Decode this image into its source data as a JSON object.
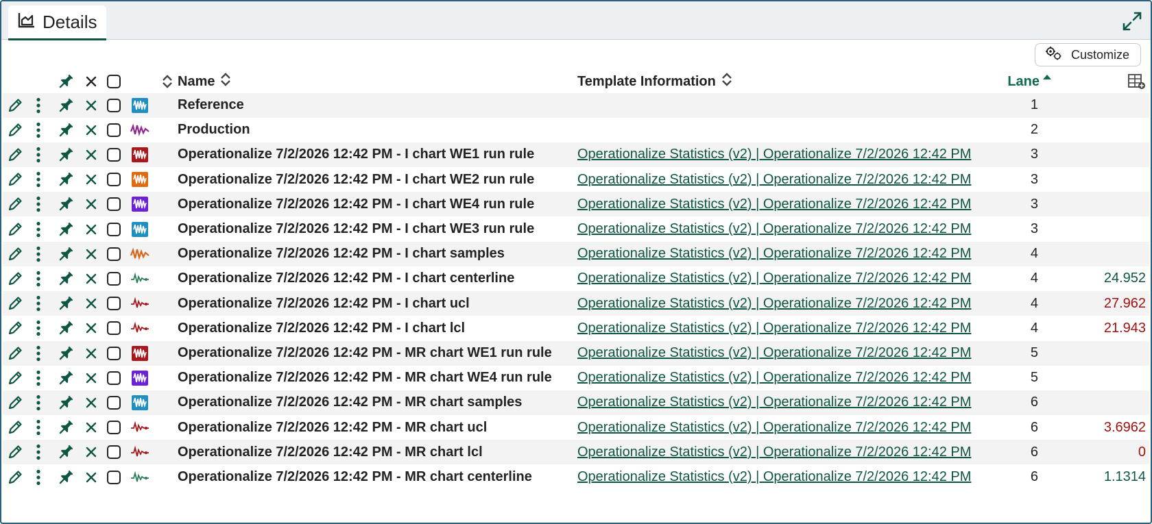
{
  "tab": {
    "label": "Details"
  },
  "toolbar": {
    "customize_label": "Customize"
  },
  "header": {
    "name": "Name",
    "template": "Template Information",
    "lane": "Lane"
  },
  "colors": {
    "accent": "#0f5543",
    "value_positive": "#0f5543",
    "value_limit": "#a01010"
  },
  "rows": [
    {
      "name": "Reference",
      "template": "",
      "lane": "1",
      "value": "",
      "icon": "signal-blue-icon"
    },
    {
      "name": "Production",
      "template": "",
      "lane": "2",
      "value": "",
      "icon": "signal-purple-icon"
    },
    {
      "name": "Operationalize 7/2/2026 12:42 PM - I chart WE1 run rule",
      "template": "Operationalize Statistics (v2) | Operationalize 7/2/2026 12:42 PM",
      "lane": "3",
      "value": "",
      "icon": "runrule-red-icon"
    },
    {
      "name": "Operationalize 7/2/2026 12:42 PM - I chart WE2 run rule",
      "template": "Operationalize Statistics (v2) | Operationalize 7/2/2026 12:42 PM",
      "lane": "3",
      "value": "",
      "icon": "runrule-orange-icon"
    },
    {
      "name": "Operationalize 7/2/2026 12:42 PM - I chart WE4 run rule",
      "template": "Operationalize Statistics (v2) | Operationalize 7/2/2026 12:42 PM",
      "lane": "3",
      "value": "",
      "icon": "runrule-purple-icon"
    },
    {
      "name": "Operationalize 7/2/2026 12:42 PM - I chart WE3 run rule",
      "template": "Operationalize Statistics (v2) | Operationalize 7/2/2026 12:42 PM",
      "lane": "3",
      "value": "",
      "icon": "runrule-blue-icon"
    },
    {
      "name": "Operationalize 7/2/2026 12:42 PM - I chart samples",
      "template": "Operationalize Statistics (v2) | Operationalize 7/2/2026 12:42 PM",
      "lane": "4",
      "value": "",
      "icon": "signal-orange-icon"
    },
    {
      "name": "Operationalize 7/2/2026 12:42 PM - I chart centerline",
      "template": "Operationalize Statistics (v2) | Operationalize 7/2/2026 12:42 PM",
      "lane": "4",
      "value": "24.952",
      "icon": "calc-green-icon"
    },
    {
      "name": "Operationalize 7/2/2026 12:42 PM - I chart ucl",
      "template": "Operationalize Statistics (v2) | Operationalize 7/2/2026 12:42 PM",
      "lane": "4",
      "value": "27.962",
      "icon": "calc-red-icon"
    },
    {
      "name": "Operationalize 7/2/2026 12:42 PM - I chart lcl",
      "template": "Operationalize Statistics (v2) | Operationalize 7/2/2026 12:42 PM",
      "lane": "4",
      "value": "21.943",
      "icon": "calc-red-icon"
    },
    {
      "name": "Operationalize 7/2/2026 12:42 PM - MR chart WE1 run rule",
      "template": "Operationalize Statistics (v2) | Operationalize 7/2/2026 12:42 PM",
      "lane": "5",
      "value": "",
      "icon": "runrule-red-icon"
    },
    {
      "name": "Operationalize 7/2/2026 12:42 PM - MR chart WE4 run rule",
      "template": "Operationalize Statistics (v2) | Operationalize 7/2/2026 12:42 PM",
      "lane": "5",
      "value": "",
      "icon": "runrule-purple-icon"
    },
    {
      "name": "Operationalize 7/2/2026 12:42 PM - MR chart samples",
      "template": "Operationalize Statistics (v2) | Operationalize 7/2/2026 12:42 PM",
      "lane": "6",
      "value": "",
      "icon": "signal-blue-icon"
    },
    {
      "name": "Operationalize 7/2/2026 12:42 PM - MR chart ucl",
      "template": "Operationalize Statistics (v2) | Operationalize 7/2/2026 12:42 PM",
      "lane": "6",
      "value": "3.6962",
      "icon": "calc-red-icon"
    },
    {
      "name": "Operationalize 7/2/2026 12:42 PM - MR chart lcl",
      "template": "Operationalize Statistics (v2) | Operationalize 7/2/2026 12:42 PM",
      "lane": "6",
      "value": "0",
      "icon": "calc-red-icon"
    },
    {
      "name": "Operationalize 7/2/2026 12:42 PM - MR chart centerline",
      "template": "Operationalize Statistics (v2) | Operationalize 7/2/2026 12:42 PM",
      "lane": "6",
      "value": "1.1314",
      "icon": "calc-green-icon"
    }
  ]
}
